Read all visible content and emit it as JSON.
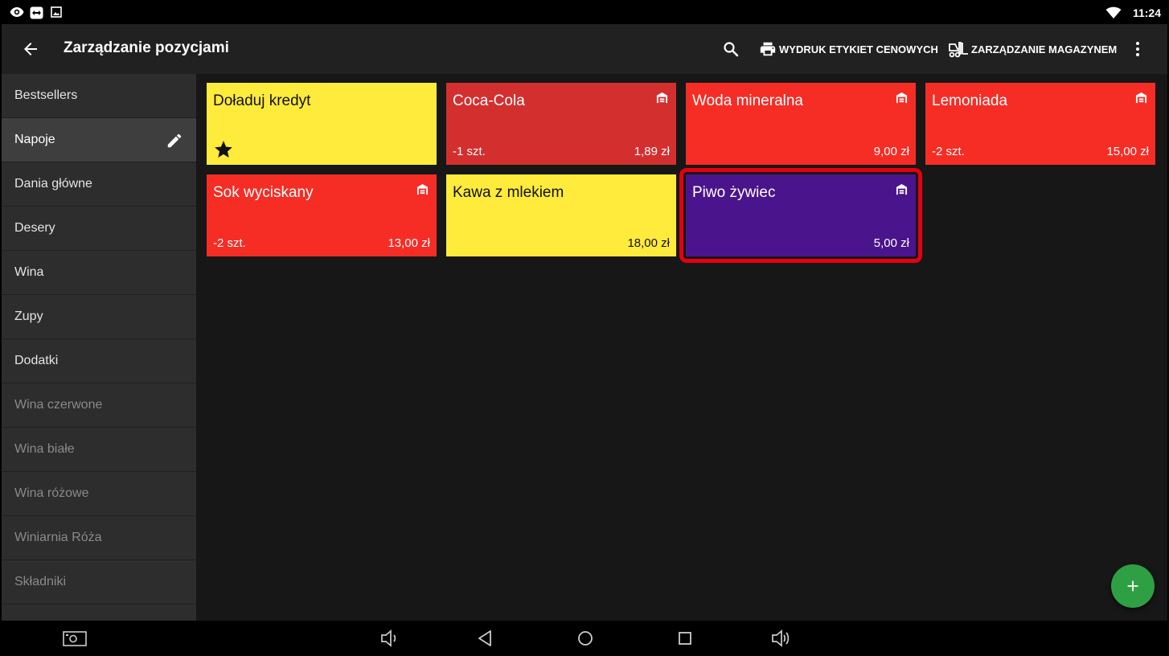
{
  "status_bar": {
    "time": "11:24",
    "icons": [
      "eye-icon",
      "teamviewer-icon",
      "image-icon",
      "wifi-icon"
    ]
  },
  "app_bar": {
    "title": "Zarządzanie pozycjami",
    "actions": {
      "print_labels": "WYDRUK ETYKIET CENOWYCH",
      "warehouse": "ZARZĄDZANIE MAGAZYNEM"
    },
    "icons": [
      "back-arrow-icon",
      "search-icon",
      "printer-icon",
      "forklift-icon",
      "more-vert-icon"
    ]
  },
  "sidebar": {
    "items": [
      {
        "label": "Bestsellers"
      },
      {
        "label": "Napoje"
      },
      {
        "label": "Dania główne"
      },
      {
        "label": "Desery"
      },
      {
        "label": "Wina"
      },
      {
        "label": "Zupy"
      },
      {
        "label": "Dodatki"
      },
      {
        "label": "Wina czerwone"
      },
      {
        "label": "Wina białe"
      },
      {
        "label": "Wina różowe"
      },
      {
        "label": "Winiarnia Róża"
      },
      {
        "label": "Składniki"
      }
    ],
    "selected": "Napoje"
  },
  "tiles": [
    {
      "name": "Doładuj kredyt",
      "quantity": "",
      "price": "",
      "color": "#ffeb3b",
      "icon": "star-icon"
    },
    {
      "name": "Coca-Cola",
      "quantity": "-1 szt.",
      "price": "1,89 zł",
      "color": "#d32f2f",
      "icon": "warehouse-icon"
    },
    {
      "name": "Woda mineralna",
      "quantity": "",
      "price": "9,00 zł",
      "color": "#f52d25",
      "icon": "warehouse-icon"
    },
    {
      "name": "Lemoniada",
      "quantity": "-2 szt.",
      "price": "15,00 zł",
      "color": "#f52d25",
      "icon": "warehouse-icon"
    },
    {
      "name": "Sok wyciskany",
      "quantity": "-2 szt.",
      "price": "13,00 zł",
      "color": "#f52d25",
      "icon": "warehouse-icon"
    },
    {
      "name": "Kawa z mlekiem",
      "quantity": "",
      "price": "18,00 zł",
      "color": "#ffeb3b",
      "icon": ""
    },
    {
      "name": "Piwo żywiec",
      "quantity": "",
      "price": "5,00 zł",
      "color": "#4a148c",
      "icon": "warehouse-icon",
      "highlighted": true
    }
  ],
  "fab": {
    "icon": "plus-icon",
    "color": "#2ea043"
  },
  "nav_bar": {
    "icons": [
      "screenshot-icon",
      "volume-down-icon",
      "back-icon",
      "home-icon",
      "recents-icon",
      "volume-up-icon"
    ]
  },
  "colors": {
    "highlight": "#e5000f",
    "background": "#171717",
    "sidebar": "#2d2d2d"
  }
}
